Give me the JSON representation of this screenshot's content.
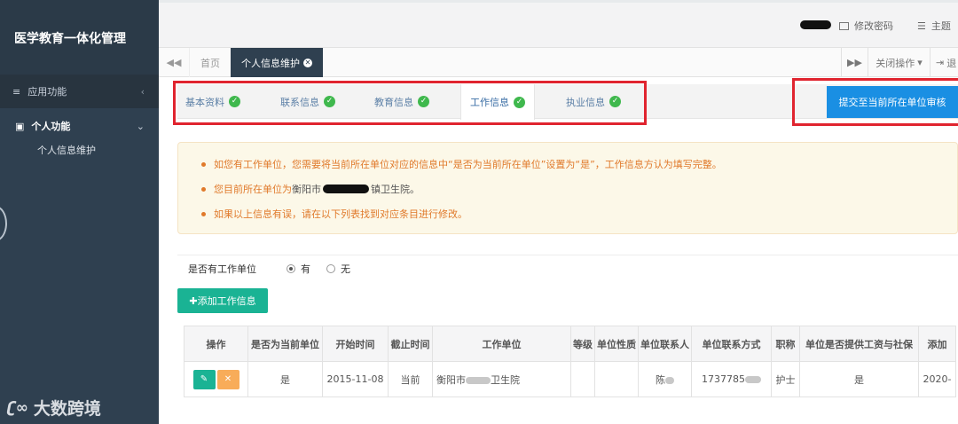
{
  "app": {
    "title": "医学教育一体化管理"
  },
  "sidebar": {
    "menu_app": "应用功能",
    "menu_personal": "个人功能",
    "sub_item": "个人信息维护"
  },
  "watermark": "大数跨境",
  "header": {
    "change_password": "修改密码",
    "theme": "主题"
  },
  "tabs": {
    "home": "首页",
    "active": "个人信息维护",
    "close_ops": "关闭操作",
    "logout_short": "退"
  },
  "info_tabs": [
    {
      "label": "基本资料"
    },
    {
      "label": "联系信息"
    },
    {
      "label": "教育信息"
    },
    {
      "label": "工作信息"
    },
    {
      "label": "执业信息"
    }
  ],
  "submit_button": "提交至当前所在单位审核",
  "notice": {
    "line1": "如您有工作单位，您需要将当前所在单位对应的信息中“是否为当前所在单位”设置为“是”，工作信息方认为填写完整。",
    "line2_prefix": "您目前所在单位为",
    "line2_unit_a": "衡阳市",
    "line2_unit_b": "镇卫生院。",
    "line3": "如果以上信息有误，请在以下列表找到对应条目进行修改。"
  },
  "form": {
    "has_unit_label": "是否有工作单位",
    "option_yes": "有",
    "option_no": "无",
    "selected": "有"
  },
  "add_button": "✚添加工作信息",
  "table": {
    "headers": [
      "操作",
      "是否为当前单位",
      "开始时间",
      "截止时间",
      "工作单位",
      "等级",
      "单位性质",
      "单位联系人",
      "单位联系方式",
      "职称",
      "单位是否提供工资与社保",
      "添加"
    ],
    "rows": [
      {
        "is_current": "是",
        "start": "2015-11-08",
        "end": "当前",
        "unit_prefix": "衡阳市",
        "unit_suffix": "卫生院",
        "level": "",
        "nature": "",
        "contact": "陈",
        "phone": "1737785",
        "title": "护士",
        "salary": "是",
        "added": "2020-"
      }
    ]
  }
}
